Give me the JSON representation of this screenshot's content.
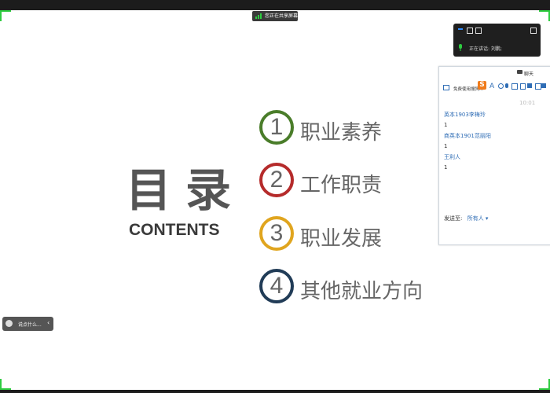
{
  "share": {
    "label": "您正在共享屏幕"
  },
  "floatbar": {
    "speaking": "正在讲话:  刘鹏;"
  },
  "slide": {
    "title_cn": "目录",
    "title_en": "CONTENTS",
    "items": [
      {
        "num": "1",
        "label": "职业素养",
        "color": "#4a7d2a"
      },
      {
        "num": "2",
        "label": "工作职责",
        "color": "#b52b2b"
      },
      {
        "num": "3",
        "label": "职业发展",
        "color": "#e0a51f"
      },
      {
        "num": "4",
        "label": "其他就业方向",
        "color": "#213c57"
      }
    ]
  },
  "chat": {
    "title": "聊天",
    "tool_label": "免费使用搜狗...",
    "time": "10:01",
    "messages": [
      {
        "name": "英本1903李梅玲",
        "text": "1"
      },
      {
        "name": "商英本1901范丽阳",
        "text": "1"
      },
      {
        "name": "王利人",
        "text": "1"
      }
    ],
    "send_to_label": "发送至:",
    "send_to_value": "所有人 ▾"
  },
  "left_pill": {
    "label": "说点什么..."
  }
}
